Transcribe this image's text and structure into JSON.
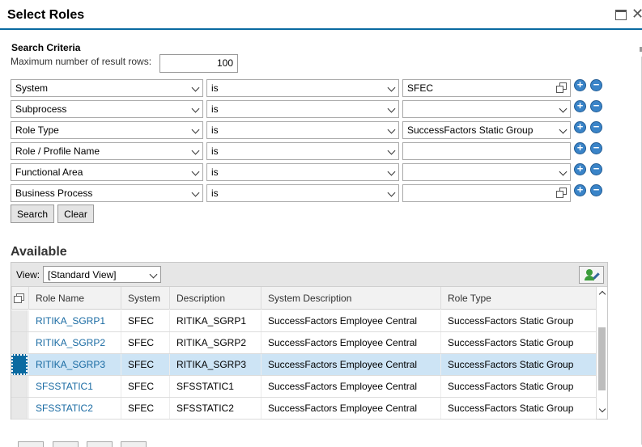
{
  "dialog": {
    "title": "Select Roles"
  },
  "search": {
    "section_label": "Search Criteria",
    "max_rows_label": "Maximum number of result rows:",
    "max_rows_value": "100",
    "criteria": [
      {
        "attribute": "System",
        "operator": "is",
        "value": "SFEC",
        "value_kind": "copy"
      },
      {
        "attribute": "Subprocess",
        "operator": "is",
        "value": "",
        "value_kind": "dropdown"
      },
      {
        "attribute": "Role Type",
        "operator": "is",
        "value": "SuccessFactors Static Group",
        "value_kind": "dropdown"
      },
      {
        "attribute": "Role / Profile Name",
        "operator": "is",
        "value": "",
        "value_kind": "text"
      },
      {
        "attribute": "Functional Area",
        "operator": "is",
        "value": "",
        "value_kind": "dropdown"
      },
      {
        "attribute": "Business Process",
        "operator": "is",
        "value": "",
        "value_kind": "copy"
      }
    ],
    "search_button": "Search",
    "clear_button": "Clear",
    "add_symbol": "+",
    "remove_symbol": "−"
  },
  "available": {
    "title": "Available",
    "view_label": "View:",
    "view_value": "[Standard View]",
    "columns": [
      "Role Name",
      "System",
      "Description",
      "System Description",
      "Role Type"
    ],
    "rows": [
      [
        "RITIKA_SGRP1",
        "SFEC",
        "RITIKA_SGRP1",
        "SuccessFactors Employee Central",
        "SuccessFactors Static Group"
      ],
      [
        "RITIKA_SGRP2",
        "SFEC",
        "RITIKA_SGRP2",
        "SuccessFactors Employee Central",
        "SuccessFactors Static Group"
      ],
      [
        "RITIKA_SGRP3",
        "SFEC",
        "RITIKA_SGRP3",
        "SuccessFactors Employee Central",
        "SuccessFactors Static Group"
      ],
      [
        "SFSSTATIC1",
        "SFEC",
        "SFSSTATIC1",
        "SuccessFactors Employee Central",
        "SuccessFactors Static Group"
      ],
      [
        "SFSSTATIC2",
        "SFEC",
        "SFSSTATIC2",
        "SuccessFactors Employee Central",
        "SuccessFactors Static Group"
      ]
    ],
    "selected_row": 2
  },
  "colors": {
    "accent": "#0a6aa1",
    "link": "#1a6ba3",
    "selected_row": "#cde4f5",
    "add_remove_button": "#3a84c8"
  }
}
